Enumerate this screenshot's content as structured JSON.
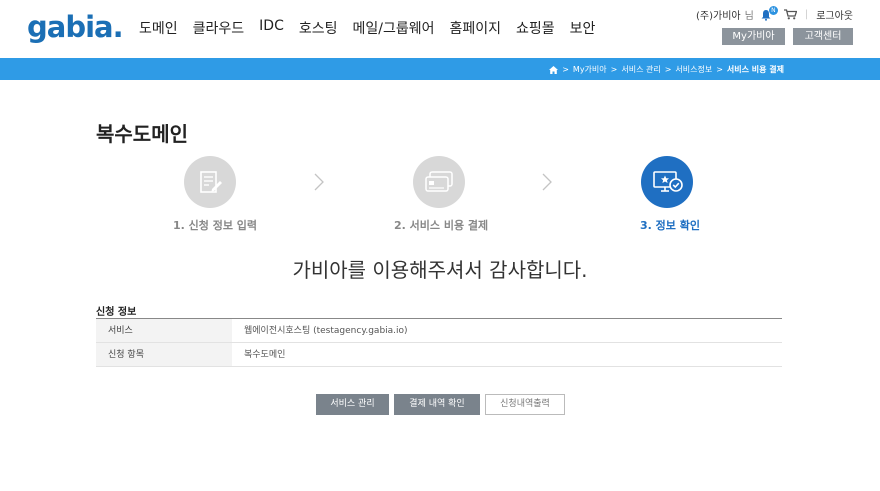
{
  "header": {
    "logo": "gabia",
    "logo_dot": ".",
    "nav": [
      "도메인",
      "클라우드",
      "IDC",
      "호스팅",
      "메일/그룹웨어",
      "홈페이지",
      "쇼핑몰",
      "보안"
    ],
    "user_name": "(주)가비아",
    "user_suffix": "님",
    "notification_count": "N",
    "logout": "로그아웃",
    "my_gabia": "My가비아",
    "customer_center": "고객센터"
  },
  "breadcrumb": {
    "items": [
      "My가비아",
      "서비스 관리",
      "서비스정보"
    ],
    "separator": ">",
    "current": "서비스 비용 결제"
  },
  "page_title": "복수도메인",
  "steps": [
    {
      "label": "1. 신청 정보 입력",
      "icon": "form-edit-icon",
      "active": false
    },
    {
      "label": "2. 서비스 비용 결제",
      "icon": "credit-card-icon",
      "active": false
    },
    {
      "label": "3. 정보 확인",
      "icon": "monitor-check-icon",
      "active": true
    }
  ],
  "thanks_message": "가비아를 이용해주셔서 감사합니다.",
  "info_section": {
    "title": "신청 정보",
    "rows": [
      {
        "label": "서비스",
        "value": "웹에이전시호스팅 (testagency.gabia.io)"
      },
      {
        "label": "신청 항목",
        "value": "복수도메인"
      }
    ]
  },
  "buttons": {
    "service_manage": "서비스 관리",
    "payment_history": "결제 내역 확인",
    "print_history": "신청내역출력"
  },
  "colors": {
    "brand": "#1b6fb5",
    "bar": "#2f9be6",
    "active_step": "#1f6fc2",
    "inactive_step": "#d8d8d8",
    "button_dark": "#7a838c"
  }
}
